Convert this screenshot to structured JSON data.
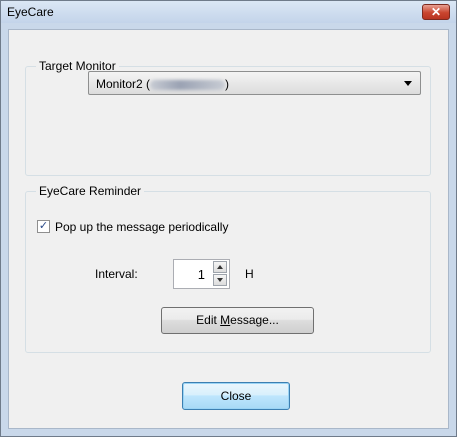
{
  "window": {
    "title": "EyeCare",
    "close_glyph": "✕"
  },
  "target_monitor": {
    "legend": "Target Monitor",
    "selected": "Monitor2 (",
    "selected_suffix": ")"
  },
  "reminder": {
    "legend": "EyeCare Reminder",
    "checkbox_label": "Pop up the message periodically",
    "checkbox_checked": true,
    "check_glyph": "✓",
    "interval_label": "Interval:",
    "interval_value": "1",
    "interval_unit": "H",
    "edit_button_pre": "Edit ",
    "edit_button_mnemonic": "M",
    "edit_button_post": "essage..."
  },
  "footer": {
    "close_label": "Close"
  }
}
